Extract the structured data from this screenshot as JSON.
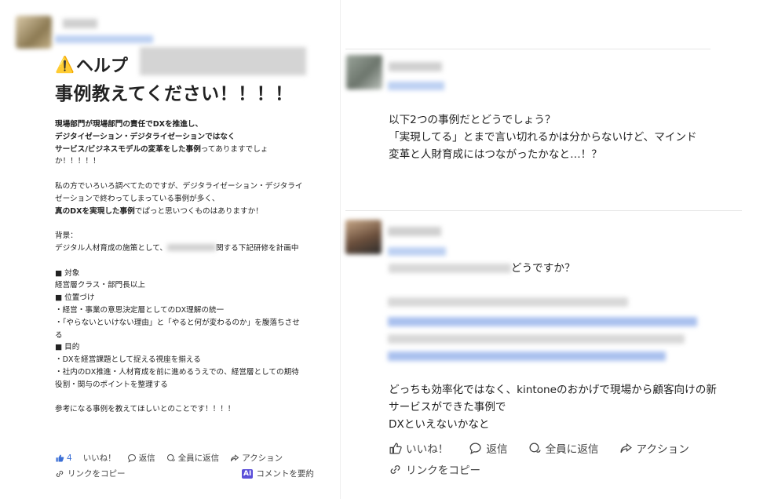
{
  "post": {
    "title_line1": "ヘルプ",
    "title_line2": "事例教えてください！！！！",
    "body_bold1": "現場部門が現場部門の責任でDXを推進し、",
    "body_bold2": "デジタイゼーション・デジタライゼーションではなく",
    "body_bold3": "サービス/ビジネスモデルの変革をした事例",
    "body_line3_rest": "ってありますでしょ",
    "body_line4": "か！！！！！",
    "body_para2_1": "私の方でいろいろ調べてたのですが、デジタライゼーション・デジタライ",
    "body_para2_2": "ゼーションで終わってしまっている事例が多く、",
    "body_para2_bold": "真のDXを実現した事例",
    "body_para2_rest": "でぱっと思いつくものはありますか！",
    "bg_label": "背景：",
    "bg_line_a": "デジタル人材育成の施策として、",
    "bg_line_b": "関する下記研修を計画中",
    "target_head": "■ 対象",
    "target_val": "経営層クラス・部門長以上",
    "pos_head": "■ 位置づけ",
    "pos_1": "・経営・事業の意思決定層としてのDX理解の統一",
    "pos_2a": "・「やらないといけない理由」と「やると何が変わるのか」を腹落ちさせ",
    "pos_2b": "る",
    "goal_head": "■ 目的",
    "goal_1": "・DXを経営課題として捉える視座を揃える",
    "goal_2a": "・社内のDX推進・人材育成を前に進めるうえでの、経営層としての期待",
    "goal_2b": "役割・関与のポイントを整理する",
    "closing": "参考になる事例を教えてほしいとのことです！！！！",
    "like_count": "4",
    "like_label": "いいね！",
    "reply_label": "返信",
    "reply_all_label": "全員に返信",
    "action_label": "アクション",
    "copy_link_label": "リンクをコピー",
    "ai_badge": "AI",
    "summarize_label": "コメントを要約"
  },
  "comments": [
    {
      "lines": [
        "以下2つの事例だとどうでしょう？",
        "「実現してる」とまで言い切れるかは分からないけど、マインド",
        "変革と人財育成にはつながったかなと…！？"
      ]
    },
    {
      "line1_rest": "どうですか？",
      "lines_after": [
        "どっちも効率化ではなく、kintoneのおかげで現場から顧客向けの新",
        "サービスができた事例で",
        "DXといえないかなと"
      ],
      "like_label": "いいね！",
      "reply_label": "返信",
      "reply_all_label": "全員に返信",
      "action_label": "アクション",
      "copy_link_label": "リンクをコピー"
    }
  ],
  "colors": {
    "like_blue": "#3b6fd6",
    "link_blue": "#5a7fd6",
    "ai_purple": "#5b4fd9"
  }
}
